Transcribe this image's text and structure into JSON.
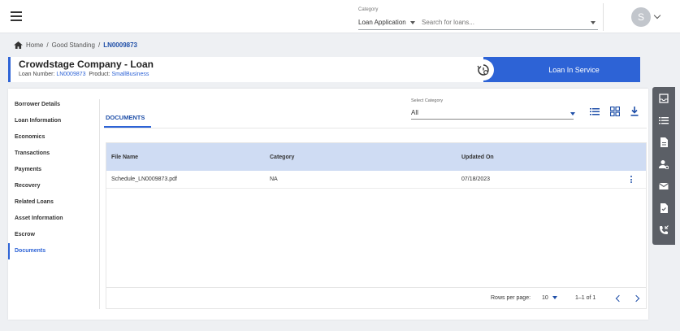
{
  "topbar": {
    "category_label": "Category",
    "category_value": "Loan Application",
    "search_placeholder": "Search for loans...",
    "avatar_initial": "S"
  },
  "breadcrumb": {
    "home": "Home",
    "sep1": "/",
    "level2": "Good Standing",
    "sep2": "/",
    "current": "LN0009873"
  },
  "loan": {
    "title": "Crowdstage Company - Loan",
    "number_label": "Loan Number:",
    "number": "LN0009873",
    "product_label": "Product:",
    "product": "SmallBusiness",
    "status": "Loan In Service"
  },
  "sidebar": {
    "items": [
      {
        "label": "Borrower Details"
      },
      {
        "label": "Loan Information"
      },
      {
        "label": "Economics"
      },
      {
        "label": "Transactions"
      },
      {
        "label": "Payments"
      },
      {
        "label": "Recovery"
      },
      {
        "label": "Related Loans"
      },
      {
        "label": "Asset Information"
      },
      {
        "label": "Escrow"
      },
      {
        "label": "Documents"
      }
    ],
    "active": "Documents"
  },
  "documents": {
    "tab_label": "DOCUMENTS",
    "select_label": "Select Category",
    "select_value": "All",
    "columns": [
      "File Name",
      "Category",
      "Updated On"
    ],
    "rows": [
      {
        "file": "Schedule_LN0009873.pdf",
        "category": "NA",
        "updated": "07/18/2023"
      }
    ],
    "rows_per_page_label": "Rows per page:",
    "rows_per_page": "10",
    "range": "1–1 of 1"
  },
  "colors": {
    "accent": "#2d63d6",
    "header_row": "#cfdcf3",
    "rail": "#5b5f66"
  }
}
